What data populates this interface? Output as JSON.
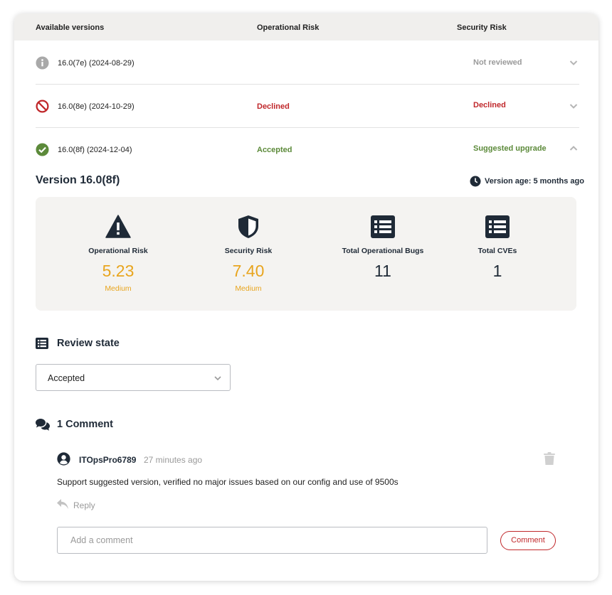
{
  "table": {
    "headers": {
      "versions": "Available versions",
      "operational": "Operational Risk",
      "security": "Security Risk"
    },
    "rows": [
      {
        "version": "16.0(7e) (2024-08-29)",
        "status_icon": "info-icon",
        "operational": "",
        "security": "Not reviewed",
        "expanded": false
      },
      {
        "version": "16.0(8e) (2024-10-29)",
        "status_icon": "prohibited-icon",
        "operational": "Declined",
        "security": "Declined",
        "expanded": false
      },
      {
        "version": "16.0(8f) (2024-12-04)",
        "status_icon": "check-circle-icon",
        "operational": "Accepted",
        "security": "Suggested upgrade",
        "expanded": true
      }
    ]
  },
  "detail": {
    "title": "Version 16.0(8f)",
    "age": "Version age: 5 months ago",
    "stats": [
      {
        "label": "Operational Risk",
        "value": "5.23",
        "sub": "Medium",
        "icon": "warning-icon"
      },
      {
        "label": "Security Risk",
        "value": "7.40",
        "sub": "Medium",
        "icon": "shield-icon"
      },
      {
        "label": "Total Operational Bugs",
        "value": "11",
        "sub": "",
        "icon": "list-icon"
      },
      {
        "label": "Total CVEs",
        "value": "1",
        "sub": "",
        "icon": "list-icon"
      }
    ]
  },
  "review": {
    "title": "Review state",
    "selected": "Accepted"
  },
  "comments": {
    "title": "1 Comment",
    "items": [
      {
        "user": "ITOpsPro6789",
        "time": "27 minutes ago",
        "text": "Support suggested version, verified no major issues based on our config and use of 9500s",
        "reply": "Reply"
      }
    ],
    "placeholder": "Add a comment",
    "submit": "Comment"
  },
  "colors": {
    "red": "#c0282b",
    "green": "#5c8a3a",
    "orange": "#e8a51f",
    "navy": "#1f2a37"
  }
}
